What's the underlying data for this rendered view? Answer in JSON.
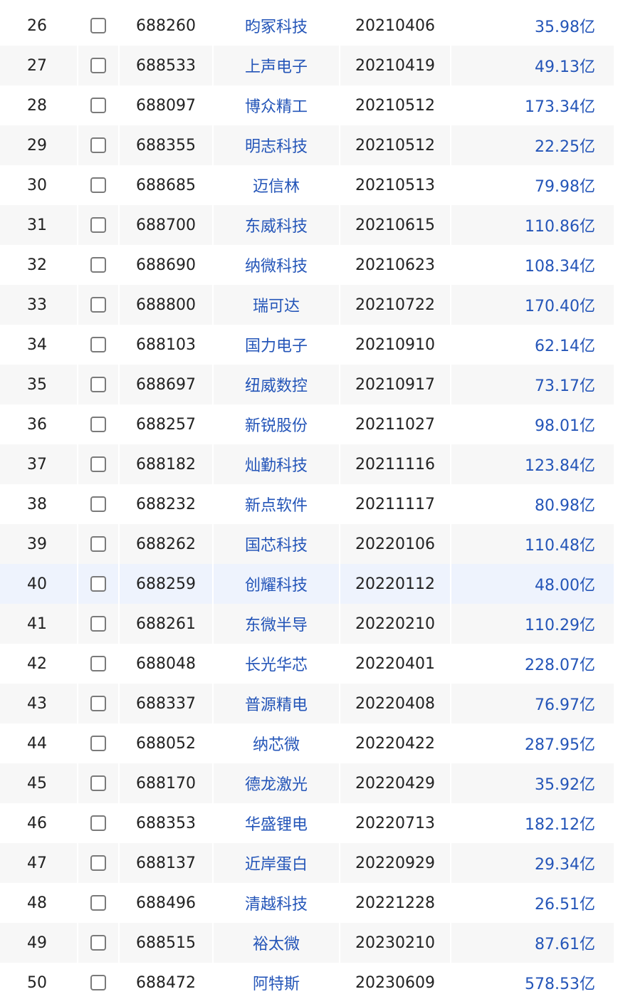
{
  "rows": [
    {
      "num": "26",
      "code": "688260",
      "name": "昀冢科技",
      "date": "20210406",
      "cap": "35.98亿"
    },
    {
      "num": "27",
      "code": "688533",
      "name": "上声电子",
      "date": "20210419",
      "cap": "49.13亿"
    },
    {
      "num": "28",
      "code": "688097",
      "name": "博众精工",
      "date": "20210512",
      "cap": "173.34亿"
    },
    {
      "num": "29",
      "code": "688355",
      "name": "明志科技",
      "date": "20210512",
      "cap": "22.25亿"
    },
    {
      "num": "30",
      "code": "688685",
      "name": "迈信林",
      "date": "20210513",
      "cap": "79.98亿"
    },
    {
      "num": "31",
      "code": "688700",
      "name": "东威科技",
      "date": "20210615",
      "cap": "110.86亿"
    },
    {
      "num": "32",
      "code": "688690",
      "name": "纳微科技",
      "date": "20210623",
      "cap": "108.34亿"
    },
    {
      "num": "33",
      "code": "688800",
      "name": "瑞可达",
      "date": "20210722",
      "cap": "170.40亿"
    },
    {
      "num": "34",
      "code": "688103",
      "name": "国力电子",
      "date": "20210910",
      "cap": "62.14亿"
    },
    {
      "num": "35",
      "code": "688697",
      "name": "纽威数控",
      "date": "20210917",
      "cap": "73.17亿"
    },
    {
      "num": "36",
      "code": "688257",
      "name": "新锐股份",
      "date": "20211027",
      "cap": "98.01亿"
    },
    {
      "num": "37",
      "code": "688182",
      "name": "灿勤科技",
      "date": "20211116",
      "cap": "123.84亿"
    },
    {
      "num": "38",
      "code": "688232",
      "name": "新点软件",
      "date": "20211117",
      "cap": "80.98亿"
    },
    {
      "num": "39",
      "code": "688262",
      "name": "国芯科技",
      "date": "20220106",
      "cap": "110.48亿"
    },
    {
      "num": "40",
      "code": "688259",
      "name": "创耀科技",
      "date": "20220112",
      "cap": "48.00亿"
    },
    {
      "num": "41",
      "code": "688261",
      "name": "东微半导",
      "date": "20220210",
      "cap": "110.29亿"
    },
    {
      "num": "42",
      "code": "688048",
      "name": "长光华芯",
      "date": "20220401",
      "cap": "228.07亿"
    },
    {
      "num": "43",
      "code": "688337",
      "name": "普源精电",
      "date": "20220408",
      "cap": "76.97亿"
    },
    {
      "num": "44",
      "code": "688052",
      "name": "纳芯微",
      "date": "20220422",
      "cap": "287.95亿"
    },
    {
      "num": "45",
      "code": "688170",
      "name": "德龙激光",
      "date": "20220429",
      "cap": "35.92亿"
    },
    {
      "num": "46",
      "code": "688353",
      "name": "华盛锂电",
      "date": "20220713",
      "cap": "182.12亿"
    },
    {
      "num": "47",
      "code": "688137",
      "name": "近岸蛋白",
      "date": "20220929",
      "cap": "29.34亿"
    },
    {
      "num": "48",
      "code": "688496",
      "name": "清越科技",
      "date": "20221228",
      "cap": "26.51亿"
    },
    {
      "num": "49",
      "code": "688515",
      "name": "裕太微",
      "date": "20230210",
      "cap": "87.61亿"
    },
    {
      "num": "50",
      "code": "688472",
      "name": "阿特斯",
      "date": "20230609",
      "cap": "578.53亿"
    }
  ],
  "highlighted_row": "40",
  "colors": {
    "link_blue": "#2455b8",
    "row_alt": "#f7f7f7",
    "row_highlight": "#eef3fd"
  }
}
